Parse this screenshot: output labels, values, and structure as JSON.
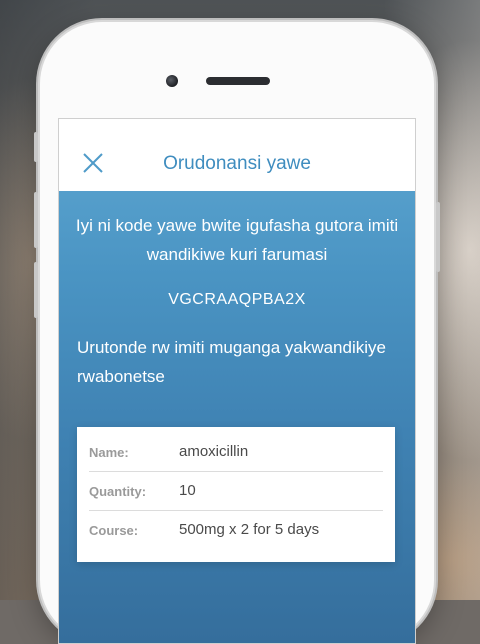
{
  "header": {
    "title": "Orudonansi yawe",
    "close_icon": "close-icon"
  },
  "intro_text": "Iyi ni kode yawe bwite igufasha gutora imiti wandikiwe kuri farumasi",
  "prescription_code": "VGCRAAQPBA2X",
  "list_heading": "Urutonde rw imiti muganga yakwandikiye rwabonetse",
  "prescription": {
    "rows": [
      {
        "label": "Name:",
        "value": "amoxicillin"
      },
      {
        "label": "Quantity:",
        "value": "10"
      },
      {
        "label": "Course:",
        "value": "500mg x 2 for 5 days"
      }
    ]
  },
  "colors": {
    "accent": "#3f8dbf",
    "screen_top": "#5ea7d2",
    "screen_bottom": "#356e9c"
  }
}
